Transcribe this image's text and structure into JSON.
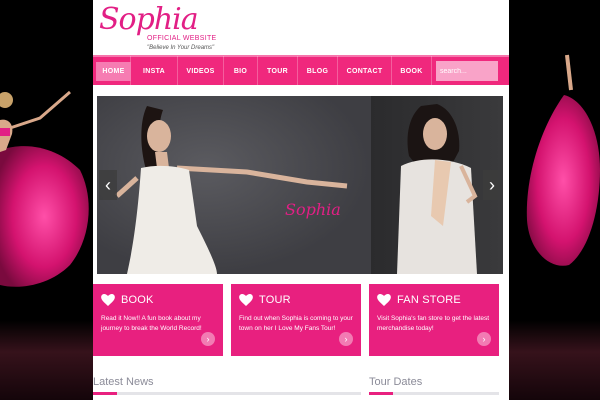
{
  "site": {
    "logo_name": "Sophia",
    "logo_sub": "OFFICIAL WEBSITE",
    "logo_tagline": "\"Believe In Your Dreams\""
  },
  "nav": {
    "items": [
      "HOME",
      "INSTA",
      "VIDEOS",
      "BIO",
      "TOUR",
      "BLOG",
      "CONTACT",
      "BOOK"
    ],
    "active": "HOME",
    "search_placeholder": "search..."
  },
  "slider": {
    "script_text": "Sophia",
    "prev": "‹",
    "next": "›"
  },
  "boxes": [
    {
      "title": "BOOK",
      "text": "Read it Now!! A fun book about my journey to break the World Record!",
      "go": "›"
    },
    {
      "title": "TOUR",
      "text": "Find out when Sophia is coming to your town on her I Love My Fans Tour!",
      "go": "›"
    },
    {
      "title": "FAN STORE",
      "text": "Visit Sophia's fan store to get the latest merchandise today!",
      "go": "›"
    }
  ],
  "sections": {
    "latest_news": "Latest News",
    "tour_dates": "Tour Dates"
  },
  "colors": {
    "brand_pink": "#e8207f",
    "nav_pink": "#f0287d"
  }
}
